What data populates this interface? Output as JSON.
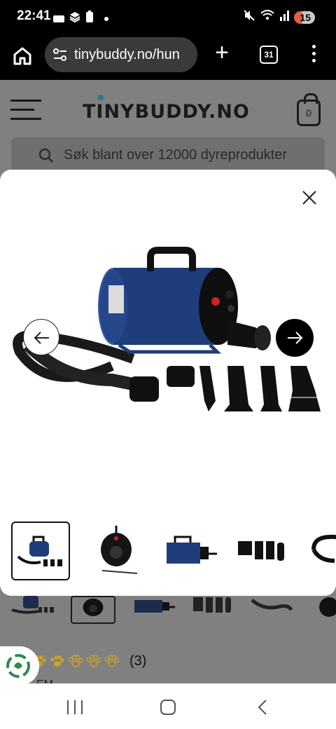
{
  "status_bar": {
    "time": "22:41",
    "battery_level": "15",
    "icons": [
      "notification-icon",
      "layers-icon",
      "battery-saver-icon",
      "dot-icon",
      "mute-icon",
      "wifi-icon",
      "signal-icon"
    ]
  },
  "browser": {
    "url": "tinybuddy.no/hun",
    "tab_count": "31"
  },
  "site": {
    "logo": "TINYBUDDY.NO",
    "cart_count": "0",
    "search_placeholder": "Søk blant over 12000 dyreprodukter"
  },
  "gallery": {
    "active_index": 0,
    "thumbnails": [
      "dryer-front",
      "dryer-back",
      "dryer-side",
      "nozzle-attachments",
      "hose"
    ]
  },
  "product": {
    "rating": 2,
    "rating_max": 5,
    "review_count": "(3)",
    "cut_text": "EM"
  },
  "colors": {
    "accent_dark": "#000000",
    "product_blue": "#1e3d7a",
    "rating_gold": "#c9a227",
    "overlay": "#808080"
  }
}
